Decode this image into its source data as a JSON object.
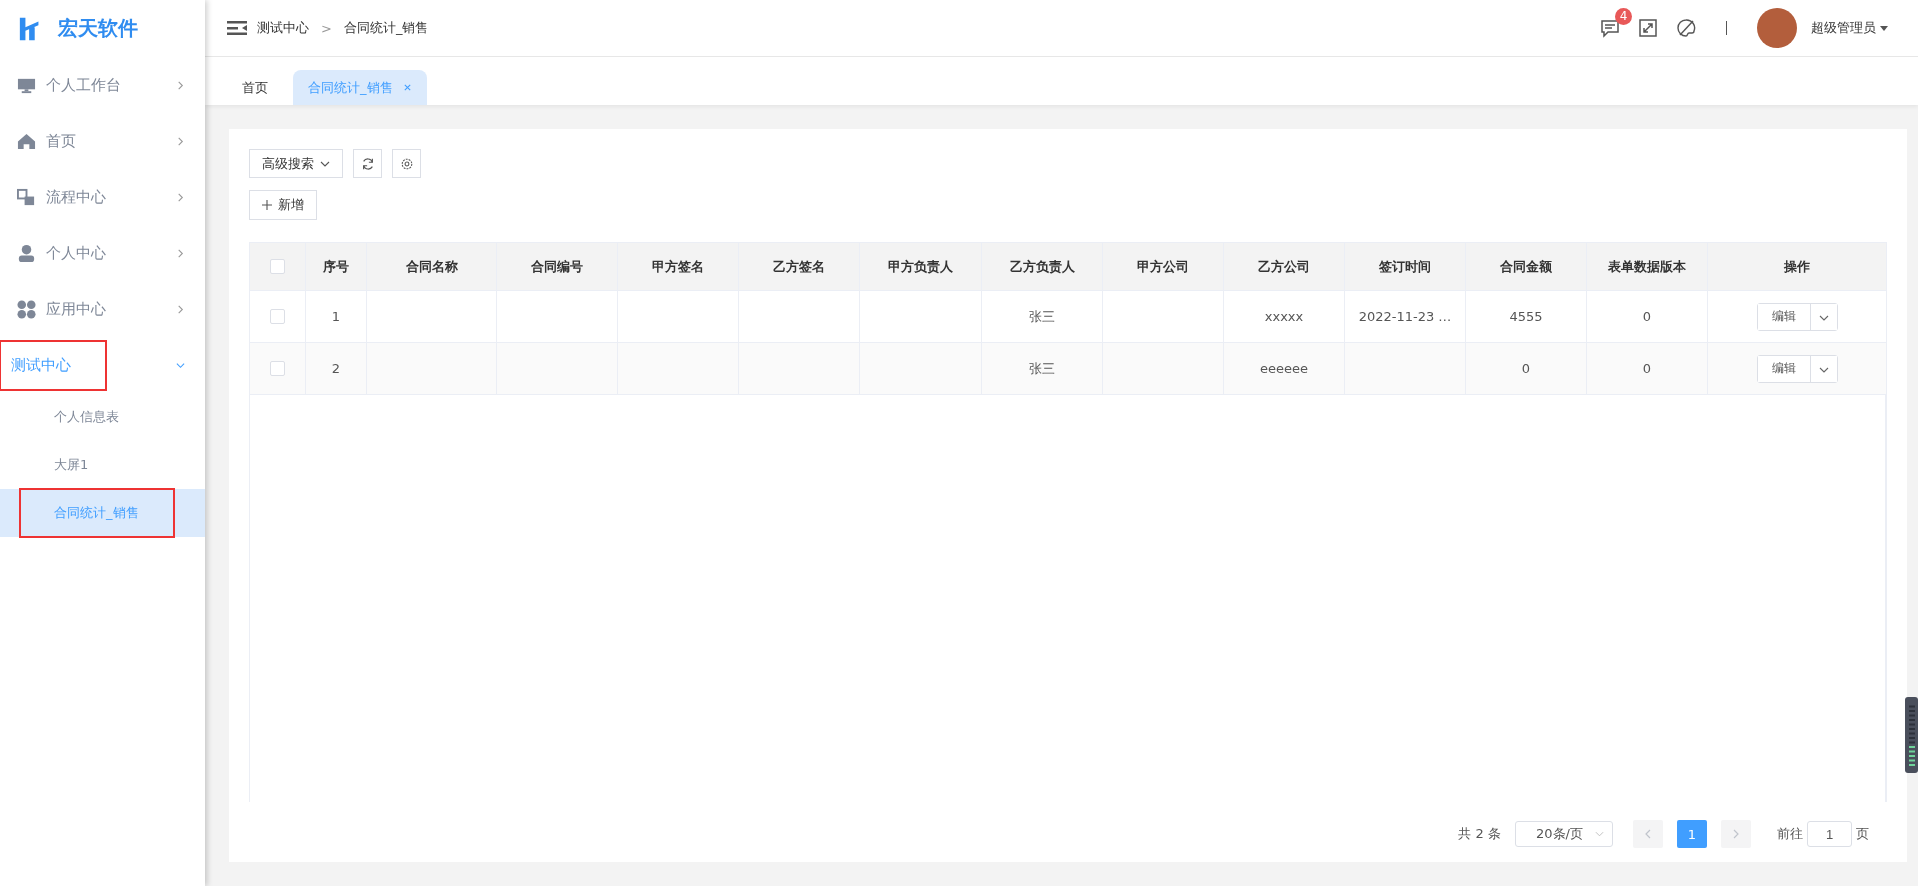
{
  "brand": {
    "name": "宏天软件"
  },
  "sidebar": {
    "items": [
      {
        "label": "个人工作台",
        "expanded": false,
        "selected": false,
        "highlighted": false
      },
      {
        "label": "首页",
        "expanded": false,
        "selected": false,
        "highlighted": false
      },
      {
        "label": "流程中心",
        "expanded": false,
        "selected": false,
        "highlighted": false
      },
      {
        "label": "个人中心",
        "expanded": false,
        "selected": false,
        "highlighted": false
      },
      {
        "label": "应用中心",
        "expanded": false,
        "selected": false,
        "highlighted": false
      },
      {
        "label": "测试中心",
        "expanded": true,
        "selected": true,
        "highlighted": true,
        "children": [
          {
            "label": "个人信息表",
            "selected": false,
            "highlighted": false
          },
          {
            "label": "大屏1",
            "selected": false,
            "highlighted": false
          },
          {
            "label": "合同统计_销售",
            "selected": true,
            "highlighted": true
          }
        ]
      }
    ]
  },
  "header": {
    "breadcrumb": [
      "测试中心",
      "合同统计_销售"
    ],
    "breadcrumb_separator": ">",
    "message_badge": "4",
    "user_name": "超级管理员"
  },
  "tabs": [
    {
      "label": "首页",
      "selected": false,
      "closable": false
    },
    {
      "label": "合同统计_销售",
      "selected": true,
      "closable": true
    }
  ],
  "toolbar": {
    "advanced_search": "高级搜索",
    "add_button": "新增"
  },
  "table": {
    "header_checked": false,
    "columns": [
      "序号",
      "合同名称",
      "合同编号",
      "甲方签名",
      "乙方签名",
      "甲方负责人",
      "乙方负责人",
      "甲方公司",
      "乙方公司",
      "签订时间",
      "合同金额",
      "表单数据版本",
      "操作"
    ],
    "rows": [
      {
        "checked": false,
        "cells": [
          "1",
          "",
          "",
          "",
          "",
          "",
          "张三",
          "",
          "xxxxx",
          "2022-11-23 …",
          "4555",
          "0"
        ],
        "action": "编辑"
      },
      {
        "checked": false,
        "cells": [
          "2",
          "",
          "",
          "",
          "",
          "",
          "张三",
          "",
          "eeeeee",
          "",
          "0",
          "0"
        ],
        "action": "编辑"
      }
    ]
  },
  "pagination": {
    "total": "共 2 条",
    "page_size": "20条/页",
    "prev_disabled": true,
    "next_disabled": true,
    "pages": [
      {
        "label": "1",
        "selected": true
      }
    ],
    "goto_label": "前往",
    "goto_value": "1",
    "goto_suffix": "页"
  }
}
